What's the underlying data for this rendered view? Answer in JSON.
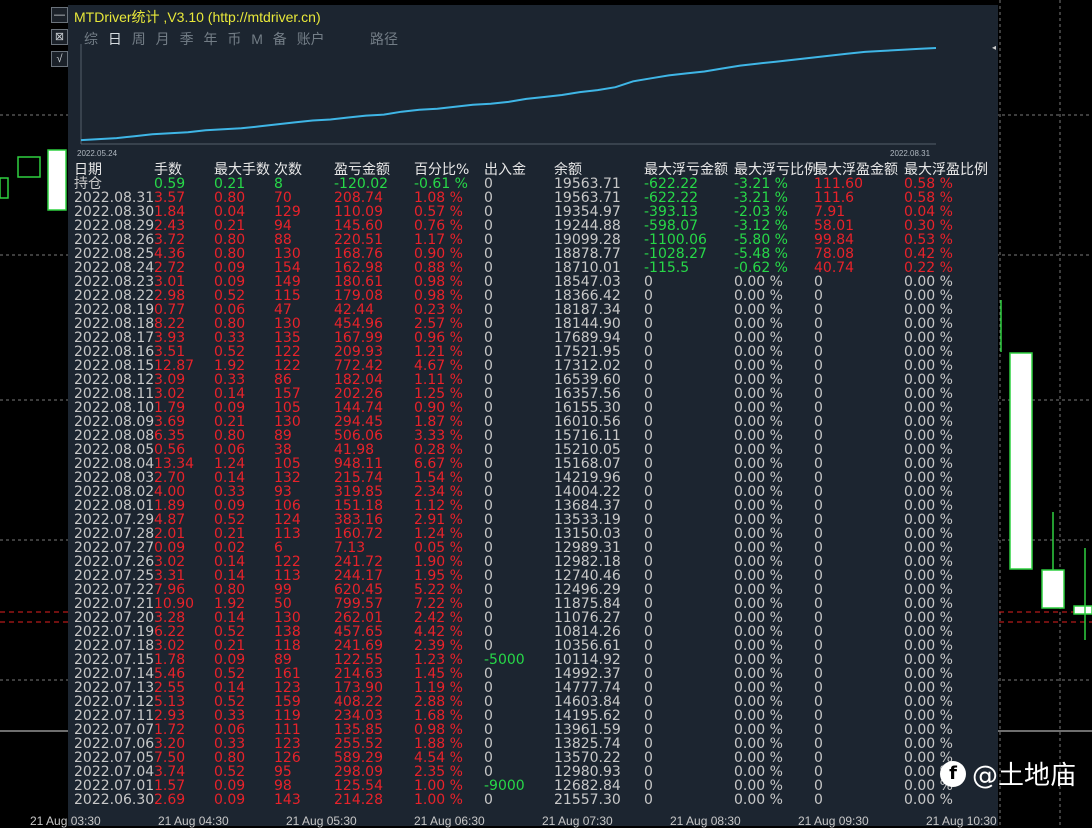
{
  "window": {
    "title": "MTDriver统计 ,V3.10 (http://mtdriver.cn)",
    "tabs": [
      "综",
      "日",
      "周",
      "月",
      "季",
      "年",
      "币",
      "M",
      "备",
      "账户"
    ],
    "active_tab": "日",
    "extra_label": "路径",
    "side_buttons": [
      "—",
      "⊠",
      "√"
    ]
  },
  "equity_curve": {
    "start_date": "2022.05.24",
    "end_date": "2022.08.31",
    "values": [
      0.04,
      0.05,
      0.06,
      0.08,
      0.1,
      0.11,
      0.12,
      0.14,
      0.15,
      0.16,
      0.18,
      0.2,
      0.22,
      0.24,
      0.25,
      0.27,
      0.29,
      0.3,
      0.33,
      0.35,
      0.36,
      0.38,
      0.4,
      0.41,
      0.43,
      0.46,
      0.48,
      0.5,
      0.53,
      0.55,
      0.58,
      0.64,
      0.67,
      0.7,
      0.72,
      0.74,
      0.77,
      0.8,
      0.82,
      0.84,
      0.86,
      0.88,
      0.9,
      0.92,
      0.94,
      0.95,
      0.96,
      0.97,
      0.98
    ]
  },
  "colors": {
    "green": "#27d848",
    "red": "#e8222a",
    "neutral": "#c8c8c8",
    "curve": "#3fb6e6",
    "panel": "#1c2530",
    "title": "#e8e83a"
  },
  "table": {
    "columns": [
      "日期",
      "手数",
      "最大手数",
      "次数",
      "盈亏金额",
      "百分比%",
      "出入金",
      "余额",
      "最大浮亏金额",
      "最大浮亏比例",
      "最大浮盈金额",
      "最大浮盈比例"
    ],
    "rows": [
      {
        "date": "持仓",
        "lots": "0.59",
        "maxlots": "0.21",
        "count": "8",
        "pl": "-120.02",
        "pct": "-0.61 %",
        "dep": "0",
        "bal": "19563.71",
        "fl": "-622.22",
        "flp": "-3.21 %",
        "fp": "111.60",
        "fpp": "0.58 %",
        "tone": "green"
      },
      {
        "date": "2022.08.31",
        "lots": "3.57",
        "maxlots": "0.80",
        "count": "70",
        "pl": "208.74",
        "pct": "1.08 %",
        "dep": "0",
        "bal": "19563.71",
        "fl": "-622.22",
        "flp": "-3.21 %",
        "fp": "111.6",
        "fpp": "0.58 %",
        "tone": "red"
      },
      {
        "date": "2022.08.30",
        "lots": "1.84",
        "maxlots": "0.04",
        "count": "129",
        "pl": "110.09",
        "pct": "0.57 %",
        "dep": "0",
        "bal": "19354.97",
        "fl": "-393.13",
        "flp": "-2.03 %",
        "fp": "7.91",
        "fpp": "0.04 %",
        "tone": "red"
      },
      {
        "date": "2022.08.29",
        "lots": "2.43",
        "maxlots": "0.21",
        "count": "94",
        "pl": "145.60",
        "pct": "0.76 %",
        "dep": "0",
        "bal": "19244.88",
        "fl": "-598.07",
        "flp": "-3.12 %",
        "fp": "58.01",
        "fpp": "0.30 %",
        "tone": "red"
      },
      {
        "date": "2022.08.26",
        "lots": "3.72",
        "maxlots": "0.80",
        "count": "88",
        "pl": "220.51",
        "pct": "1.17 %",
        "dep": "0",
        "bal": "19099.28",
        "fl": "-1100.06",
        "flp": "-5.80 %",
        "fp": "99.84",
        "fpp": "0.53 %",
        "tone": "red"
      },
      {
        "date": "2022.08.25",
        "lots": "4.36",
        "maxlots": "0.80",
        "count": "130",
        "pl": "168.76",
        "pct": "0.90 %",
        "dep": "0",
        "bal": "18878.77",
        "fl": "-1028.27",
        "flp": "-5.48 %",
        "fp": "78.08",
        "fpp": "0.42 %",
        "tone": "red"
      },
      {
        "date": "2022.08.24",
        "lots": "2.72",
        "maxlots": "0.09",
        "count": "154",
        "pl": "162.98",
        "pct": "0.88 %",
        "dep": "0",
        "bal": "18710.01",
        "fl": "-115.5",
        "flp": "-0.62 %",
        "fp": "40.74",
        "fpp": "0.22 %",
        "tone": "red"
      },
      {
        "date": "2022.08.23",
        "lots": "3.01",
        "maxlots": "0.09",
        "count": "149",
        "pl": "180.61",
        "pct": "0.98 %",
        "dep": "0",
        "bal": "18547.03",
        "fl": "0",
        "flp": "0.00 %",
        "fp": "0",
        "fpp": "0.00 %",
        "tone": "red"
      },
      {
        "date": "2022.08.22",
        "lots": "2.98",
        "maxlots": "0.52",
        "count": "115",
        "pl": "179.08",
        "pct": "0.98 %",
        "dep": "0",
        "bal": "18366.42",
        "fl": "0",
        "flp": "0.00 %",
        "fp": "0",
        "fpp": "0.00 %",
        "tone": "red"
      },
      {
        "date": "2022.08.19",
        "lots": "0.77",
        "maxlots": "0.06",
        "count": "47",
        "pl": "42.44",
        "pct": "0.23 %",
        "dep": "0",
        "bal": "18187.34",
        "fl": "0",
        "flp": "0.00 %",
        "fp": "0",
        "fpp": "0.00 %",
        "tone": "red"
      },
      {
        "date": "2022.08.18",
        "lots": "8.22",
        "maxlots": "0.80",
        "count": "130",
        "pl": "454.96",
        "pct": "2.57 %",
        "dep": "0",
        "bal": "18144.90",
        "fl": "0",
        "flp": "0.00 %",
        "fp": "0",
        "fpp": "0.00 %",
        "tone": "red"
      },
      {
        "date": "2022.08.17",
        "lots": "3.93",
        "maxlots": "0.33",
        "count": "135",
        "pl": "167.99",
        "pct": "0.96 %",
        "dep": "0",
        "bal": "17689.94",
        "fl": "0",
        "flp": "0.00 %",
        "fp": "0",
        "fpp": "0.00 %",
        "tone": "red"
      },
      {
        "date": "2022.08.16",
        "lots": "3.51",
        "maxlots": "0.52",
        "count": "122",
        "pl": "209.93",
        "pct": "1.21 %",
        "dep": "0",
        "bal": "17521.95",
        "fl": "0",
        "flp": "0.00 %",
        "fp": "0",
        "fpp": "0.00 %",
        "tone": "red"
      },
      {
        "date": "2022.08.15",
        "lots": "12.87",
        "maxlots": "1.92",
        "count": "122",
        "pl": "772.42",
        "pct": "4.67 %",
        "dep": "0",
        "bal": "17312.02",
        "fl": "0",
        "flp": "0.00 %",
        "fp": "0",
        "fpp": "0.00 %",
        "tone": "red"
      },
      {
        "date": "2022.08.12",
        "lots": "3.09",
        "maxlots": "0.33",
        "count": "86",
        "pl": "182.04",
        "pct": "1.11 %",
        "dep": "0",
        "bal": "16539.60",
        "fl": "0",
        "flp": "0.00 %",
        "fp": "0",
        "fpp": "0.00 %",
        "tone": "red"
      },
      {
        "date": "2022.08.11",
        "lots": "3.02",
        "maxlots": "0.14",
        "count": "157",
        "pl": "202.26",
        "pct": "1.25 %",
        "dep": "0",
        "bal": "16357.56",
        "fl": "0",
        "flp": "0.00 %",
        "fp": "0",
        "fpp": "0.00 %",
        "tone": "red"
      },
      {
        "date": "2022.08.10",
        "lots": "1.79",
        "maxlots": "0.09",
        "count": "105",
        "pl": "144.74",
        "pct": "0.90 %",
        "dep": "0",
        "bal": "16155.30",
        "fl": "0",
        "flp": "0.00 %",
        "fp": "0",
        "fpp": "0.00 %",
        "tone": "red"
      },
      {
        "date": "2022.08.09",
        "lots": "3.69",
        "maxlots": "0.21",
        "count": "130",
        "pl": "294.45",
        "pct": "1.87 %",
        "dep": "0",
        "bal": "16010.56",
        "fl": "0",
        "flp": "0.00 %",
        "fp": "0",
        "fpp": "0.00 %",
        "tone": "red"
      },
      {
        "date": "2022.08.08",
        "lots": "6.35",
        "maxlots": "0.80",
        "count": "89",
        "pl": "506.06",
        "pct": "3.33 %",
        "dep": "0",
        "bal": "15716.11",
        "fl": "0",
        "flp": "0.00 %",
        "fp": "0",
        "fpp": "0.00 %",
        "tone": "red"
      },
      {
        "date": "2022.08.05",
        "lots": "0.56",
        "maxlots": "0.06",
        "count": "38",
        "pl": "41.98",
        "pct": "0.28 %",
        "dep": "0",
        "bal": "15210.05",
        "fl": "0",
        "flp": "0.00 %",
        "fp": "0",
        "fpp": "0.00 %",
        "tone": "red"
      },
      {
        "date": "2022.08.04",
        "lots": "13.34",
        "maxlots": "1.24",
        "count": "105",
        "pl": "948.11",
        "pct": "6.67 %",
        "dep": "0",
        "bal": "15168.07",
        "fl": "0",
        "flp": "0.00 %",
        "fp": "0",
        "fpp": "0.00 %",
        "tone": "red"
      },
      {
        "date": "2022.08.03",
        "lots": "2.70",
        "maxlots": "0.14",
        "count": "132",
        "pl": "215.74",
        "pct": "1.54 %",
        "dep": "0",
        "bal": "14219.96",
        "fl": "0",
        "flp": "0.00 %",
        "fp": "0",
        "fpp": "0.00 %",
        "tone": "red"
      },
      {
        "date": "2022.08.02",
        "lots": "4.00",
        "maxlots": "0.33",
        "count": "93",
        "pl": "319.85",
        "pct": "2.34 %",
        "dep": "0",
        "bal": "14004.22",
        "fl": "0",
        "flp": "0.00 %",
        "fp": "0",
        "fpp": "0.00 %",
        "tone": "red"
      },
      {
        "date": "2022.08.01",
        "lots": "1.89",
        "maxlots": "0.09",
        "count": "106",
        "pl": "151.18",
        "pct": "1.12 %",
        "dep": "0",
        "bal": "13684.37",
        "fl": "0",
        "flp": "0.00 %",
        "fp": "0",
        "fpp": "0.00 %",
        "tone": "red"
      },
      {
        "date": "2022.07.29",
        "lots": "4.87",
        "maxlots": "0.52",
        "count": "124",
        "pl": "383.16",
        "pct": "2.91 %",
        "dep": "0",
        "bal": "13533.19",
        "fl": "0",
        "flp": "0.00 %",
        "fp": "0",
        "fpp": "0.00 %",
        "tone": "red"
      },
      {
        "date": "2022.07.28",
        "lots": "2.01",
        "maxlots": "0.21",
        "count": "113",
        "pl": "160.72",
        "pct": "1.24 %",
        "dep": "0",
        "bal": "13150.03",
        "fl": "0",
        "flp": "0.00 %",
        "fp": "0",
        "fpp": "0.00 %",
        "tone": "red"
      },
      {
        "date": "2022.07.27",
        "lots": "0.09",
        "maxlots": "0.02",
        "count": "6",
        "pl": "7.13",
        "pct": "0.05 %",
        "dep": "0",
        "bal": "12989.31",
        "fl": "0",
        "flp": "0.00 %",
        "fp": "0",
        "fpp": "0.00 %",
        "tone": "red"
      },
      {
        "date": "2022.07.26",
        "lots": "3.02",
        "maxlots": "0.14",
        "count": "122",
        "pl": "241.72",
        "pct": "1.90 %",
        "dep": "0",
        "bal": "12982.18",
        "fl": "0",
        "flp": "0.00 %",
        "fp": "0",
        "fpp": "0.00 %",
        "tone": "red"
      },
      {
        "date": "2022.07.25",
        "lots": "3.31",
        "maxlots": "0.14",
        "count": "113",
        "pl": "244.17",
        "pct": "1.95 %",
        "dep": "0",
        "bal": "12740.46",
        "fl": "0",
        "flp": "0.00 %",
        "fp": "0",
        "fpp": "0.00 %",
        "tone": "red"
      },
      {
        "date": "2022.07.22",
        "lots": "7.96",
        "maxlots": "0.80",
        "count": "99",
        "pl": "620.45",
        "pct": "5.22 %",
        "dep": "0",
        "bal": "12496.29",
        "fl": "0",
        "flp": "0.00 %",
        "fp": "0",
        "fpp": "0.00 %",
        "tone": "red"
      },
      {
        "date": "2022.07.21",
        "lots": "10.90",
        "maxlots": "1.92",
        "count": "50",
        "pl": "799.57",
        "pct": "7.22 %",
        "dep": "0",
        "bal": "11875.84",
        "fl": "0",
        "flp": "0.00 %",
        "fp": "0",
        "fpp": "0.00 %",
        "tone": "red"
      },
      {
        "date": "2022.07.20",
        "lots": "3.28",
        "maxlots": "0.14",
        "count": "130",
        "pl": "262.01",
        "pct": "2.42 %",
        "dep": "0",
        "bal": "11076.27",
        "fl": "0",
        "flp": "0.00 %",
        "fp": "0",
        "fpp": "0.00 %",
        "tone": "red"
      },
      {
        "date": "2022.07.19",
        "lots": "6.22",
        "maxlots": "0.52",
        "count": "138",
        "pl": "457.65",
        "pct": "4.42 %",
        "dep": "0",
        "bal": "10814.26",
        "fl": "0",
        "flp": "0.00 %",
        "fp": "0",
        "fpp": "0.00 %",
        "tone": "red"
      },
      {
        "date": "2022.07.18",
        "lots": "3.02",
        "maxlots": "0.21",
        "count": "118",
        "pl": "241.69",
        "pct": "2.39 %",
        "dep": "0",
        "bal": "10356.61",
        "fl": "0",
        "flp": "0.00 %",
        "fp": "0",
        "fpp": "0.00 %",
        "tone": "red"
      },
      {
        "date": "2022.07.15",
        "lots": "1.78",
        "maxlots": "0.09",
        "count": "89",
        "pl": "122.55",
        "pct": "1.23 %",
        "dep": "-5000",
        "bal": "10114.92",
        "fl": "0",
        "flp": "0.00 %",
        "fp": "0",
        "fpp": "0.00 %",
        "tone": "red",
        "dep_tone": "green"
      },
      {
        "date": "2022.07.14",
        "lots": "5.46",
        "maxlots": "0.52",
        "count": "161",
        "pl": "214.63",
        "pct": "1.45 %",
        "dep": "0",
        "bal": "14992.37",
        "fl": "0",
        "flp": "0.00 %",
        "fp": "0",
        "fpp": "0.00 %",
        "tone": "red"
      },
      {
        "date": "2022.07.13",
        "lots": "2.55",
        "maxlots": "0.14",
        "count": "123",
        "pl": "173.90",
        "pct": "1.19 %",
        "dep": "0",
        "bal": "14777.74",
        "fl": "0",
        "flp": "0.00 %",
        "fp": "0",
        "fpp": "0.00 %",
        "tone": "red"
      },
      {
        "date": "2022.07.12",
        "lots": "5.13",
        "maxlots": "0.52",
        "count": "159",
        "pl": "408.22",
        "pct": "2.88 %",
        "dep": "0",
        "bal": "14603.84",
        "fl": "0",
        "flp": "0.00 %",
        "fp": "0",
        "fpp": "0.00 %",
        "tone": "red"
      },
      {
        "date": "2022.07.11",
        "lots": "2.93",
        "maxlots": "0.33",
        "count": "119",
        "pl": "234.03",
        "pct": "1.68 %",
        "dep": "0",
        "bal": "14195.62",
        "fl": "0",
        "flp": "0.00 %",
        "fp": "0",
        "fpp": "0.00 %",
        "tone": "red"
      },
      {
        "date": "2022.07.07",
        "lots": "1.72",
        "maxlots": "0.06",
        "count": "111",
        "pl": "135.85",
        "pct": "0.98 %",
        "dep": "0",
        "bal": "13961.59",
        "fl": "0",
        "flp": "0.00 %",
        "fp": "0",
        "fpp": "0.00 %",
        "tone": "red"
      },
      {
        "date": "2022.07.06",
        "lots": "3.20",
        "maxlots": "0.33",
        "count": "123",
        "pl": "255.52",
        "pct": "1.88 %",
        "dep": "0",
        "bal": "13825.74",
        "fl": "0",
        "flp": "0.00 %",
        "fp": "0",
        "fpp": "0.00 %",
        "tone": "red"
      },
      {
        "date": "2022.07.05",
        "lots": "7.50",
        "maxlots": "0.80",
        "count": "126",
        "pl": "589.29",
        "pct": "4.54 %",
        "dep": "0",
        "bal": "13570.22",
        "fl": "0",
        "flp": "0.00 %",
        "fp": "0",
        "fpp": "0.00 %",
        "tone": "red"
      },
      {
        "date": "2022.07.04",
        "lots": "3.74",
        "maxlots": "0.52",
        "count": "95",
        "pl": "298.09",
        "pct": "2.35 %",
        "dep": "0",
        "bal": "12980.93",
        "fl": "0",
        "flp": "0.00 %",
        "fp": "0",
        "fpp": "0.00 %",
        "tone": "red"
      },
      {
        "date": "2022.07.01",
        "lots": "1.57",
        "maxlots": "0.09",
        "count": "98",
        "pl": "125.54",
        "pct": "1.00 %",
        "dep": "-9000",
        "bal": "12682.84",
        "fl": "0",
        "flp": "0.00 %",
        "fp": "0",
        "fpp": "0.00 %",
        "tone": "red",
        "dep_tone": "green"
      },
      {
        "date": "2022.06.30",
        "lots": "2.69",
        "maxlots": "0.09",
        "count": "143",
        "pl": "214.28",
        "pct": "1.00 %",
        "dep": "0",
        "bal": "21557.30",
        "fl": "0",
        "flp": "0.00 %",
        "fp": "0",
        "fpp": "0.00 %",
        "tone": "red"
      }
    ]
  },
  "time_axis": [
    "21 Aug 03:30",
    "21 Aug 04:30",
    "21 Aug 05:30",
    "21 Aug 06:30",
    "21 Aug 07:30",
    "21 Aug 08:30",
    "21 Aug 09:30",
    "21 Aug 10:30"
  ],
  "watermark": {
    "icon": "f",
    "text": "@土地庙"
  }
}
